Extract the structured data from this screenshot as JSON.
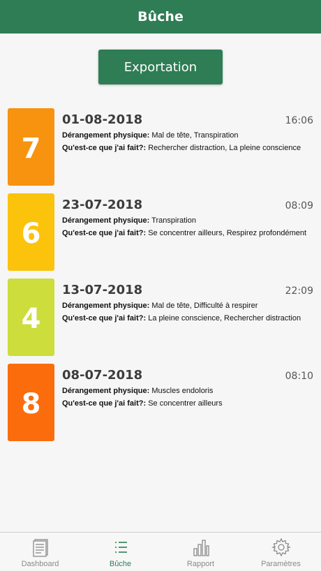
{
  "header": {
    "title": "Bûche"
  },
  "export_button": {
    "label": "Exportation"
  },
  "labels": {
    "physical": "Dérangement physique:",
    "did": "Qu'est-ce que j'ai fait?:"
  },
  "entries": [
    {
      "score": "7",
      "color": "#f7930f",
      "date": "01-08-2018",
      "time": "16:06",
      "physical": "Mal de tête, Transpiration",
      "actions": "Rechercher distraction, La pleine conscience"
    },
    {
      "score": "6",
      "color": "#fbc30b",
      "date": "23-07-2018",
      "time": "08:09",
      "physical": "Transpiration",
      "actions": "Se concentrer ailleurs, Respirez profondément"
    },
    {
      "score": "4",
      "color": "#ccdd3c",
      "date": "13-07-2018",
      "time": "22:09",
      "physical": "Mal de tête, Difficulté à respirer",
      "actions": "La pleine conscience, Rechercher distraction"
    },
    {
      "score": "8",
      "color": "#fb6d0c",
      "date": "08-07-2018",
      "time": "08:10",
      "physical": "Muscles endoloris",
      "actions": "Se concentrer ailleurs"
    }
  ],
  "tabs": [
    {
      "label": "Dashboard",
      "icon": "document-icon",
      "active": false
    },
    {
      "label": "Bûche",
      "icon": "list-icon",
      "active": true
    },
    {
      "label": "Rapport",
      "icon": "bar-chart-icon",
      "active": false
    },
    {
      "label": "Paramètres",
      "icon": "gear-icon",
      "active": false
    }
  ],
  "colors": {
    "brand": "#2e7d55",
    "tab_inactive": "#8a8a8a"
  }
}
